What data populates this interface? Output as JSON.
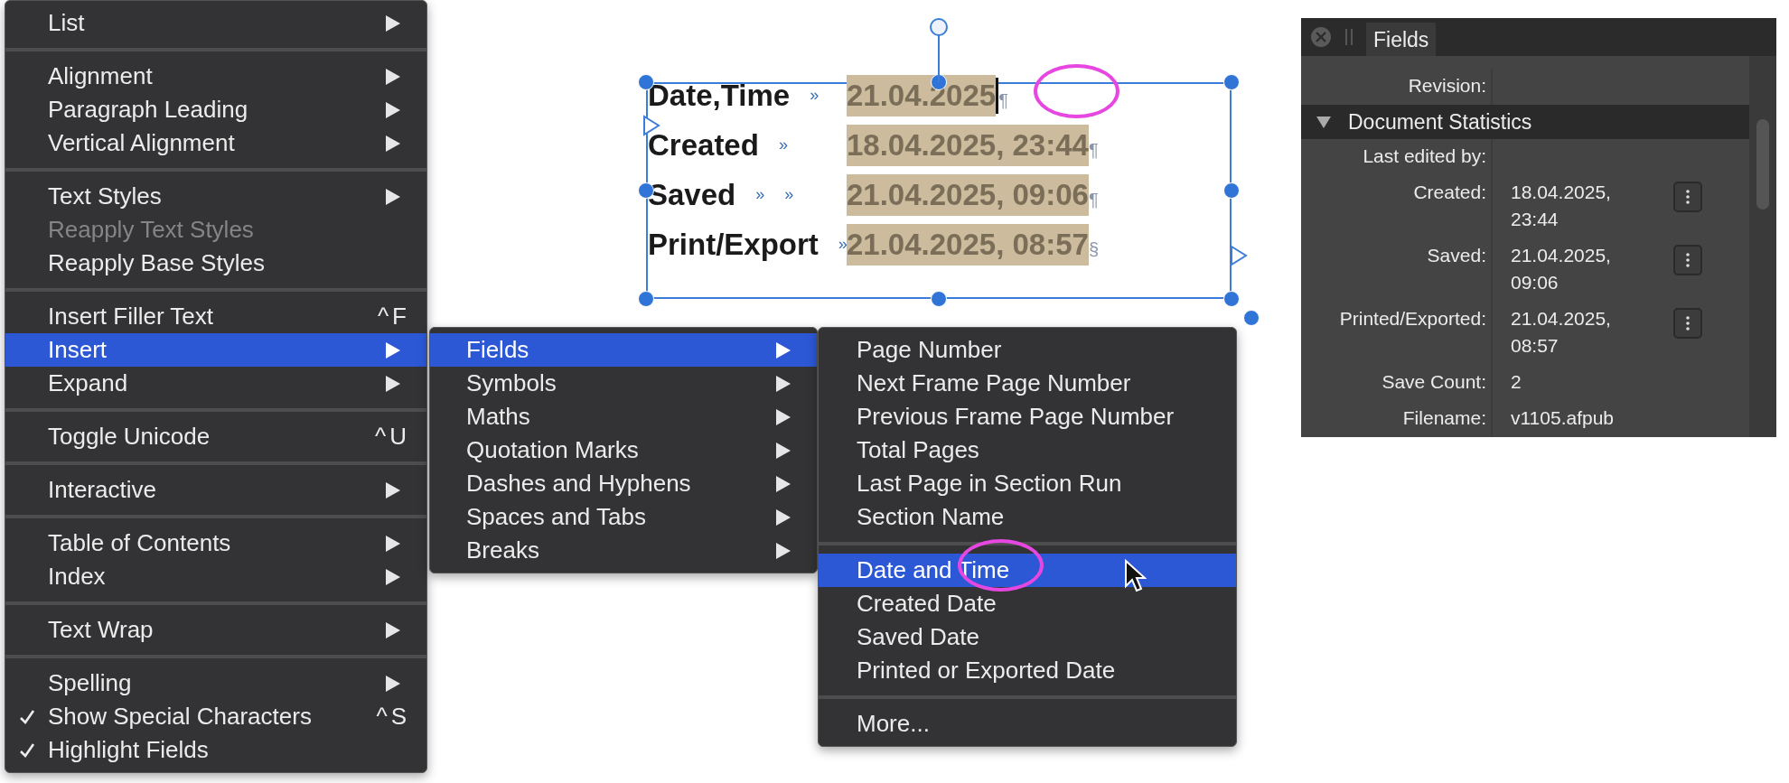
{
  "context_menu": {
    "items": [
      {
        "kind": "item",
        "label": "List",
        "has_submenu": true,
        "checked": false,
        "disabled": false,
        "selected": false
      },
      {
        "kind": "separator"
      },
      {
        "kind": "item",
        "label": "Alignment",
        "has_submenu": true,
        "checked": false,
        "disabled": false,
        "selected": false
      },
      {
        "kind": "item",
        "label": "Paragraph Leading",
        "has_submenu": true,
        "checked": false,
        "disabled": false,
        "selected": false
      },
      {
        "kind": "item",
        "label": "Vertical Alignment",
        "has_submenu": true,
        "checked": false,
        "disabled": false,
        "selected": false
      },
      {
        "kind": "separator"
      },
      {
        "kind": "item",
        "label": "Text Styles",
        "has_submenu": true,
        "checked": false,
        "disabled": false,
        "selected": false
      },
      {
        "kind": "item",
        "label": "Reapply Text Styles",
        "has_submenu": false,
        "checked": false,
        "disabled": true,
        "selected": false
      },
      {
        "kind": "item",
        "label": "Reapply Base Styles",
        "has_submenu": false,
        "checked": false,
        "disabled": false,
        "selected": false
      },
      {
        "kind": "separator"
      },
      {
        "kind": "item",
        "label": "Insert Filler Text",
        "shortcut": "^F",
        "has_submenu": false,
        "checked": false,
        "disabled": false,
        "selected": false
      },
      {
        "kind": "item",
        "label": "Insert",
        "has_submenu": true,
        "checked": false,
        "disabled": false,
        "selected": true
      },
      {
        "kind": "item",
        "label": "Expand",
        "has_submenu": true,
        "checked": false,
        "disabled": false,
        "selected": false
      },
      {
        "kind": "separator"
      },
      {
        "kind": "item",
        "label": "Toggle Unicode",
        "shortcut": "^U",
        "has_submenu": false,
        "checked": false,
        "disabled": false,
        "selected": false
      },
      {
        "kind": "separator"
      },
      {
        "kind": "item",
        "label": "Interactive",
        "has_submenu": true,
        "checked": false,
        "disabled": false,
        "selected": false
      },
      {
        "kind": "separator"
      },
      {
        "kind": "item",
        "label": "Table of Contents",
        "has_submenu": true,
        "checked": false,
        "disabled": false,
        "selected": false
      },
      {
        "kind": "item",
        "label": "Index",
        "has_submenu": true,
        "checked": false,
        "disabled": false,
        "selected": false
      },
      {
        "kind": "separator"
      },
      {
        "kind": "item",
        "label": "Text Wrap",
        "has_submenu": true,
        "checked": false,
        "disabled": false,
        "selected": false
      },
      {
        "kind": "separator"
      },
      {
        "kind": "item",
        "label": "Spelling",
        "has_submenu": true,
        "checked": false,
        "disabled": false,
        "selected": false
      },
      {
        "kind": "item",
        "label": "Show Special Characters",
        "shortcut": "^S",
        "has_submenu": false,
        "checked": true,
        "disabled": false,
        "selected": false
      },
      {
        "kind": "item",
        "label": "Highlight Fields",
        "has_submenu": false,
        "checked": true,
        "disabled": false,
        "selected": false
      }
    ]
  },
  "insert_submenu": {
    "items": [
      {
        "kind": "item",
        "label": "Fields",
        "has_submenu": true,
        "selected": true
      },
      {
        "kind": "item",
        "label": "Symbols",
        "has_submenu": true,
        "selected": false
      },
      {
        "kind": "item",
        "label": "Maths",
        "has_submenu": true,
        "selected": false
      },
      {
        "kind": "item",
        "label": "Quotation Marks",
        "has_submenu": true,
        "selected": false
      },
      {
        "kind": "item",
        "label": "Dashes and Hyphens",
        "has_submenu": true,
        "selected": false
      },
      {
        "kind": "item",
        "label": "Spaces and Tabs",
        "has_submenu": true,
        "selected": false
      },
      {
        "kind": "item",
        "label": "Breaks",
        "has_submenu": true,
        "selected": false
      }
    ]
  },
  "fields_submenu": {
    "items": [
      {
        "kind": "item",
        "label": "Page Number",
        "selected": false
      },
      {
        "kind": "item",
        "label": "Next Frame Page Number",
        "selected": false
      },
      {
        "kind": "item",
        "label": "Previous Frame Page Number",
        "selected": false
      },
      {
        "kind": "item",
        "label": "Total Pages",
        "selected": false
      },
      {
        "kind": "item",
        "label": "Last Page in Section Run",
        "selected": false
      },
      {
        "kind": "item",
        "label": "Section Name",
        "selected": false
      },
      {
        "kind": "separator"
      },
      {
        "kind": "item",
        "label": "Date and Time",
        "selected": true
      },
      {
        "kind": "item",
        "label": "Created Date",
        "selected": false
      },
      {
        "kind": "item",
        "label": "Saved Date",
        "selected": false
      },
      {
        "kind": "item",
        "label": "Printed or Exported Date",
        "selected": false
      },
      {
        "kind": "separator"
      },
      {
        "kind": "item",
        "label": "More...",
        "selected": false
      }
    ]
  },
  "text_frame": {
    "lines": [
      {
        "label": "Date,Time",
        "tab_marks": [
          "»"
        ],
        "value": "21.04.2025",
        "end_mark": "¶",
        "caret": true
      },
      {
        "label": "Created",
        "tab_marks": [
          "»"
        ],
        "value": "18.04.2025, 23:44",
        "end_mark": "¶",
        "caret": false
      },
      {
        "label": "Saved",
        "tab_marks": [
          "»",
          "»"
        ],
        "value": "21.04.2025, 09:06",
        "end_mark": "¶",
        "caret": false
      },
      {
        "label": "Print/Export",
        "tab_marks": [
          "»"
        ],
        "value": "21.04.2025, 08:57",
        "end_mark": "§",
        "caret": false
      }
    ]
  },
  "fields_panel": {
    "tab": "Fields",
    "rows_before": [
      {
        "label": "Revision:",
        "menu_button": false
      }
    ],
    "section": {
      "title": "Document Statistics",
      "expanded": true
    },
    "rows": [
      {
        "label": "Last edited by:",
        "menu_button": false
      },
      {
        "label": "Created:",
        "value": "18.04.2025, 23:44",
        "menu_button": true
      },
      {
        "label": "Saved:",
        "value": "21.04.2025, 09:06",
        "menu_button": true
      },
      {
        "label": "Printed/Exported:",
        "value": "21.04.2025, 08:57",
        "menu_button": true
      },
      {
        "label": "Save Count:",
        "value": "2",
        "menu_button": false
      },
      {
        "label": "Filename:",
        "value": "v1105.afpub",
        "menu_button": false
      }
    ]
  }
}
